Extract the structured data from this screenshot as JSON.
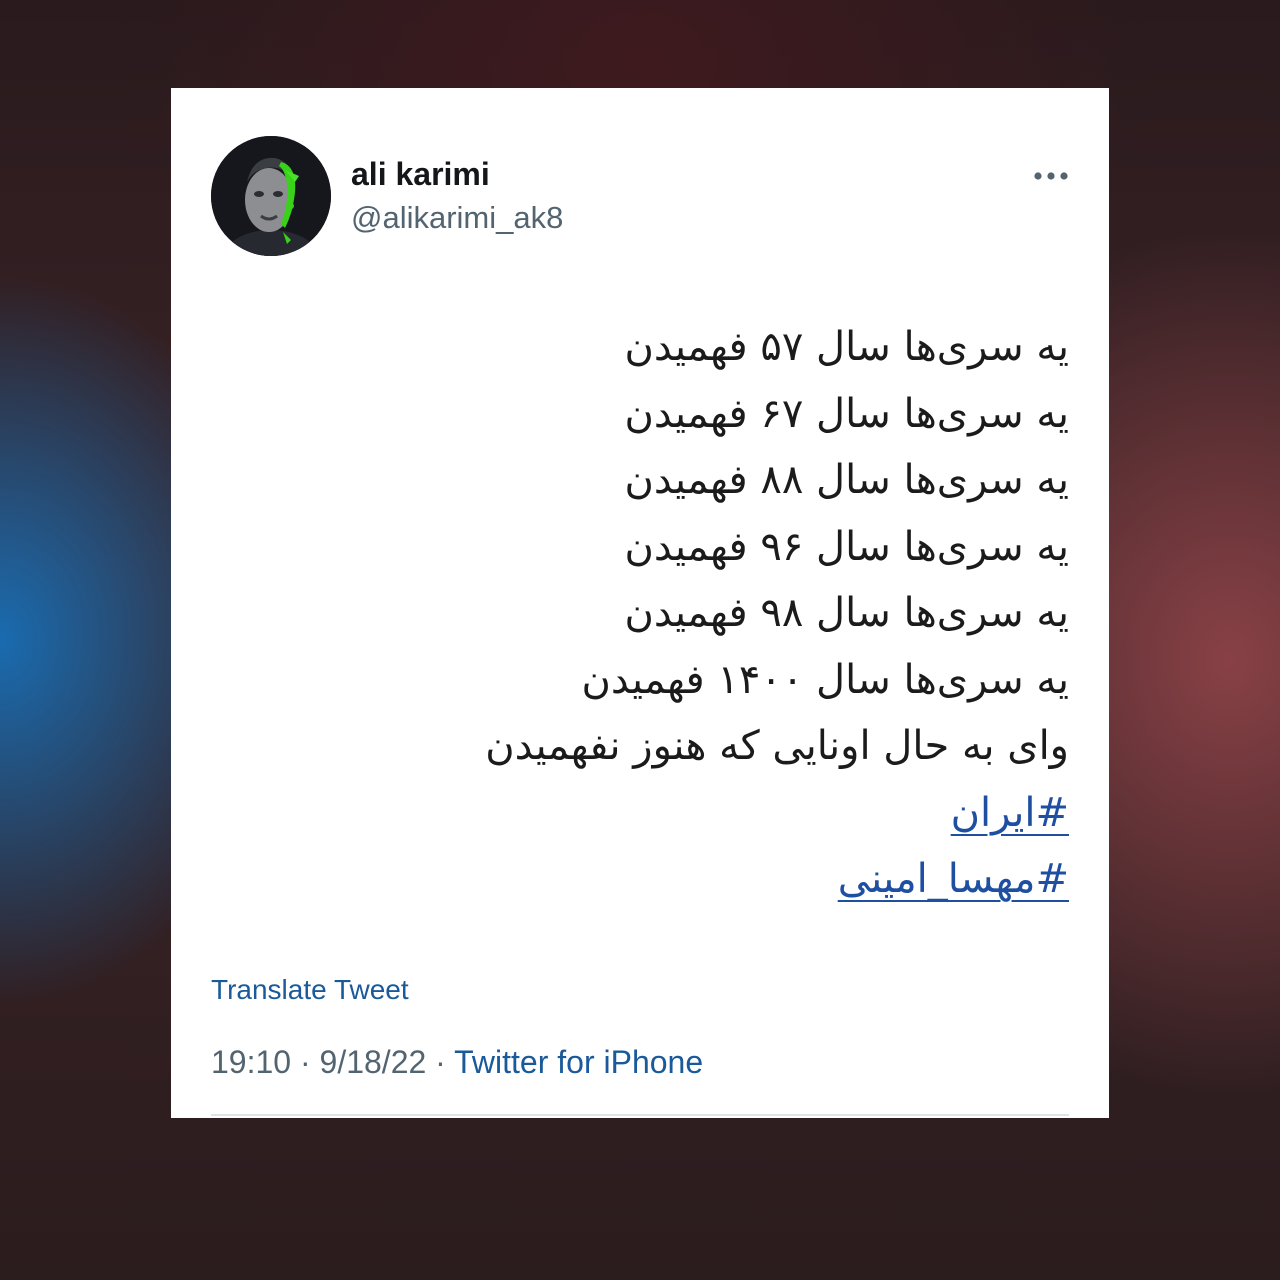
{
  "tweet": {
    "author": {
      "display_name": "ali karimi",
      "handle": "@alikarimi_ak8",
      "avatar_icon": "profile-photo"
    },
    "more_icon": "more-horizontal-icon",
    "lines": [
      "یه سری‌ها سال ۵۷ فهمیدن",
      "یه سری‌ها سال ۶۷ فهمیدن",
      "یه سری‌ها سال ۸۸ فهمیدن",
      "یه سری‌ها سال ۹۶ فهمیدن",
      "یه سری‌ها سال ۹۸ فهمیدن",
      "یه سری‌ها سال ۱۴۰۰ فهمیدن",
      "وای به حال اونایی که هنوز نفهمیدن"
    ],
    "hashtags": [
      "#ایران",
      "#مهسا_امینی"
    ],
    "translate_label": "Translate Tweet",
    "time": "19:10",
    "separator": "·",
    "date": "9/18/22",
    "source": "Twitter for iPhone"
  },
  "colors": {
    "link": "#1a5a9a",
    "hashtag": "#1e4fa0",
    "secondary_text": "#536471"
  }
}
